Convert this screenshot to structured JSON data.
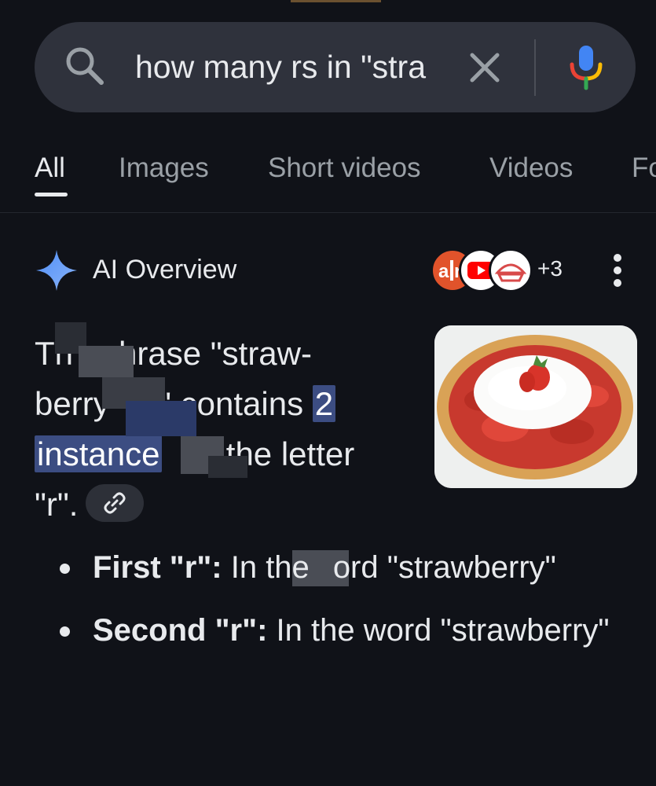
{
  "search": {
    "query": "how many rs in \"stra"
  },
  "tabs": [
    {
      "label": "All",
      "active": true
    },
    {
      "label": "Images"
    },
    {
      "label": "Short videos"
    },
    {
      "label": "Videos"
    },
    {
      "label": "Fo"
    }
  ],
  "ai_overview": {
    "title": "AI Overview",
    "sources_more": "+3",
    "answer_lines": {
      "l1a": "Th",
      "l1b": "hrase \"straw-",
      "l2a": "berry",
      "l2b": "e\" contains",
      "l2hl": "2",
      "l3hl": "instance",
      "l3b": "f the letter",
      "l4": "\"r\"."
    },
    "bullets": [
      {
        "bold": "First \"r\":",
        "text": " In the",
        "text2": "ord \"strawberry\""
      },
      {
        "bold": "Second \"r\":",
        "text": " In the word \"strawberry\""
      }
    ]
  },
  "colors": {
    "background": "#101218",
    "search_bg": "#2f323c",
    "highlight": "#3c4d82"
  },
  "icons": [
    "search-icon",
    "clear-icon",
    "mic-icon",
    "sparkle-icon",
    "more-vert-icon",
    "link-icon"
  ]
}
